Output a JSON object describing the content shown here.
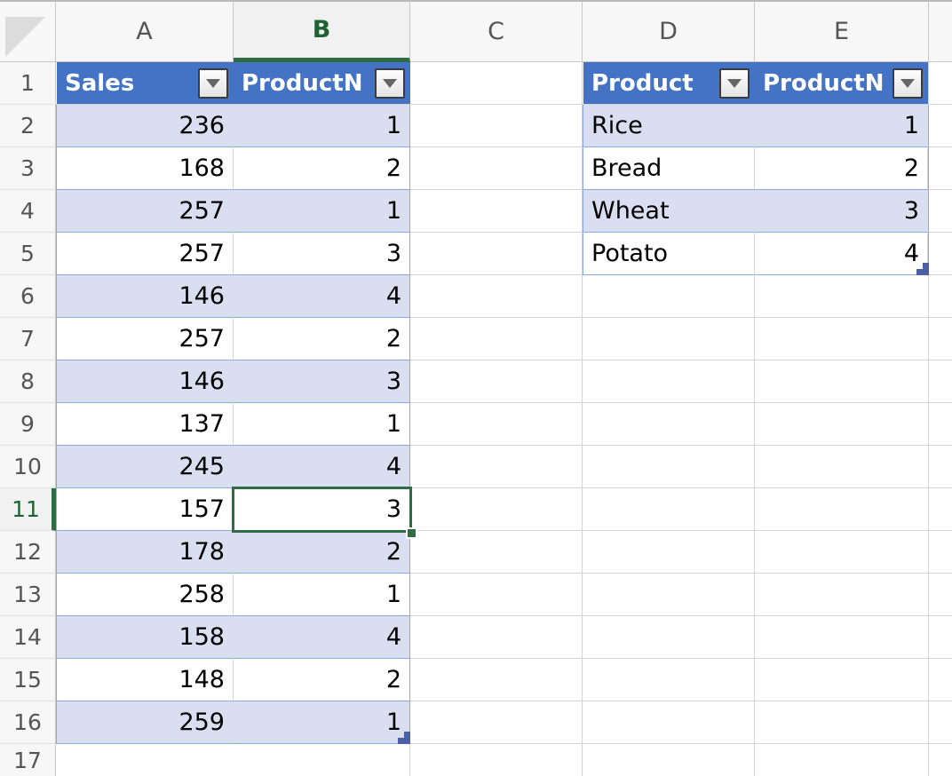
{
  "grid": {
    "select_all_label": "select-all",
    "columns": [
      "A",
      "B",
      "C",
      "D",
      "E"
    ],
    "active_column": "B",
    "rows": [
      "1",
      "2",
      "3",
      "4",
      "5",
      "6",
      "7",
      "8",
      "9",
      "10",
      "11",
      "12",
      "13",
      "14",
      "15",
      "16",
      "17"
    ],
    "active_row": "11",
    "active_cell": "B11"
  },
  "colors": {
    "table_header_blue": "#4472C4",
    "banded_row_fill": "#D9DEF0",
    "table_border_blue": "#8EA9DB",
    "active_cell_green": "#2F6B43",
    "header_text_green": "#1F6334",
    "gridline": "#D4D4D4",
    "header_bar_gray": "#F7F7F7",
    "resize_grip_blue": "#4A5FA5"
  },
  "table_left": {
    "name": "sales-table",
    "headers": [
      {
        "label": "Sales",
        "column": "A",
        "filter_icon": "filter-dropdown-icon"
      },
      {
        "label": "ProductN",
        "column": "B",
        "filter_icon": "filter-dropdown-icon"
      }
    ],
    "rows": [
      {
        "row": "2",
        "sales": "236",
        "productn": "1"
      },
      {
        "row": "3",
        "sales": "168",
        "productn": "2"
      },
      {
        "row": "4",
        "sales": "257",
        "productn": "1"
      },
      {
        "row": "5",
        "sales": "257",
        "productn": "3"
      },
      {
        "row": "6",
        "sales": "146",
        "productn": "4"
      },
      {
        "row": "7",
        "sales": "257",
        "productn": "2"
      },
      {
        "row": "8",
        "sales": "146",
        "productn": "3"
      },
      {
        "row": "9",
        "sales": "137",
        "productn": "1"
      },
      {
        "row": "10",
        "sales": "245",
        "productn": "4"
      },
      {
        "row": "11",
        "sales": "157",
        "productn": "3"
      },
      {
        "row": "12",
        "sales": "178",
        "productn": "2"
      },
      {
        "row": "13",
        "sales": "258",
        "productn": "1"
      },
      {
        "row": "14",
        "sales": "158",
        "productn": "4"
      },
      {
        "row": "15",
        "sales": "148",
        "productn": "2"
      },
      {
        "row": "16",
        "sales": "259",
        "productn": "1"
      }
    ]
  },
  "table_right": {
    "name": "product-lookup-table",
    "headers": [
      {
        "label": "Product",
        "column": "D",
        "filter_icon": "filter-dropdown-icon"
      },
      {
        "label": "ProductN",
        "column": "E",
        "filter_icon": "filter-dropdown-icon"
      }
    ],
    "rows": [
      {
        "row": "2",
        "product": "Rice",
        "productn": "1"
      },
      {
        "row": "3",
        "product": "Bread",
        "productn": "2"
      },
      {
        "row": "4",
        "product": "Wheat",
        "productn": "3"
      },
      {
        "row": "5",
        "product": "Potato",
        "productn": "4"
      }
    ]
  }
}
